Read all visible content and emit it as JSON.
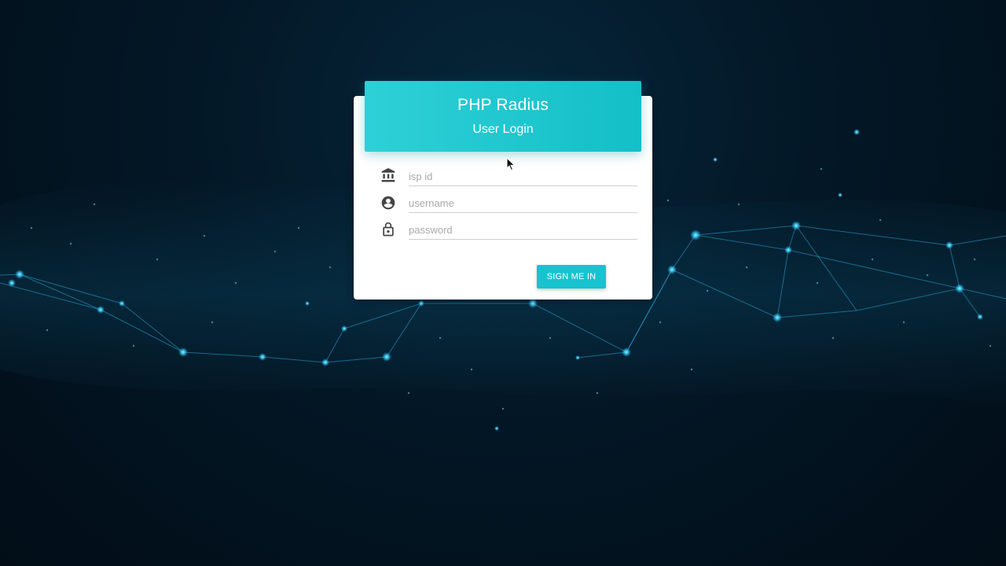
{
  "header": {
    "title": "PHP Radius",
    "subtitle": "User Login"
  },
  "form": {
    "isp_id": {
      "placeholder": "isp id",
      "value": "",
      "icon": "bank-icon"
    },
    "username": {
      "placeholder": "username",
      "value": "",
      "icon": "account-circle-icon"
    },
    "password": {
      "placeholder": "password",
      "value": "",
      "icon": "lock-icon"
    },
    "submit_label": "SIGN ME IN"
  },
  "colors": {
    "accent": "#17c3cf",
    "header_gradient_start": "#2ed0d6",
    "header_gradient_end": "#14bfc8",
    "background": "#031726"
  }
}
